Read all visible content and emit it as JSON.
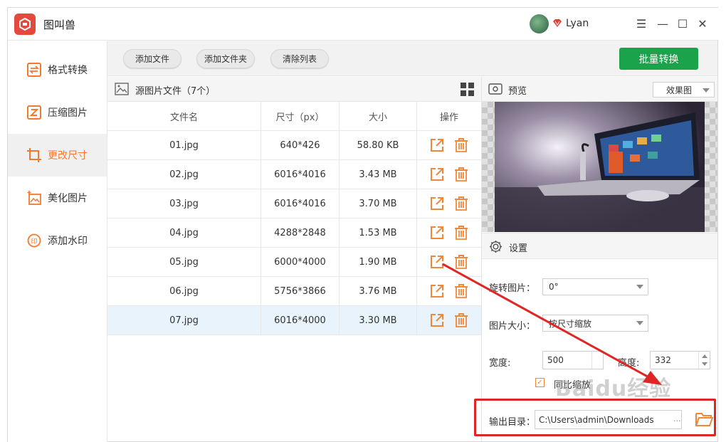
{
  "app": {
    "title": "图叫兽",
    "user_name": "Lyan"
  },
  "window_controls": {
    "menu": "☰",
    "minimize": "—",
    "maximize": "☐",
    "close": "✕"
  },
  "sidebar": {
    "items": [
      {
        "label": "格式转换",
        "icon": "convert-icon",
        "active": false
      },
      {
        "label": "压缩图片",
        "icon": "compress-icon",
        "active": false
      },
      {
        "label": "更改尺寸",
        "icon": "resize-icon",
        "active": true
      },
      {
        "label": "美化图片",
        "icon": "beautify-icon",
        "active": false
      },
      {
        "label": "添加水印",
        "icon": "watermark-icon",
        "active": false
      }
    ]
  },
  "toolbar": {
    "add_file": "添加文件",
    "add_folder": "添加文件夹",
    "clear_list": "清除列表",
    "batch_convert": "批量转换"
  },
  "files": {
    "title": "源图片文件（7个）",
    "columns": [
      "文件名",
      "尺寸（px）",
      "大小",
      "操作"
    ],
    "rows": [
      {
        "name": "01.jpg",
        "size_px": "640*426",
        "size": "58.80 KB"
      },
      {
        "name": "02.jpg",
        "size_px": "6016*4016",
        "size": "3.43 MB"
      },
      {
        "name": "03.jpg",
        "size_px": "6016*4016",
        "size": "3.70 MB"
      },
      {
        "name": "04.jpg",
        "size_px": "4288*2848",
        "size": "1.53 MB"
      },
      {
        "name": "05.jpg",
        "size_px": "6000*4000",
        "size": "1.90 MB"
      },
      {
        "name": "06.jpg",
        "size_px": "5756*3866",
        "size": "3.76 MB"
      },
      {
        "name": "07.jpg",
        "size_px": "6016*4000",
        "size": "3.30 MB"
      }
    ],
    "selected_index": 6
  },
  "preview": {
    "title": "预览",
    "mode": "效果图"
  },
  "settings": {
    "title": "设置",
    "rotate_label": "旋转图片：",
    "rotate_value": "0°",
    "size_label": "图片大小：",
    "size_value": "按尺寸缩放",
    "width_label": "宽度:",
    "width_value": "500",
    "height_label": "高度:",
    "height_value": "332",
    "proportional_label": "同比缩放",
    "proportional_checked": true,
    "output_label": "输出目录：",
    "output_path": "C:\\Users\\admin\\Downloads",
    "output_suffix": "..."
  },
  "overlay": {
    "watermark": "Baidu经验"
  },
  "colors": {
    "accent": "#f27a2e",
    "primary_button": "#1aa34a",
    "highlight": "#e02525",
    "selected_row": "#e8f3fb"
  }
}
